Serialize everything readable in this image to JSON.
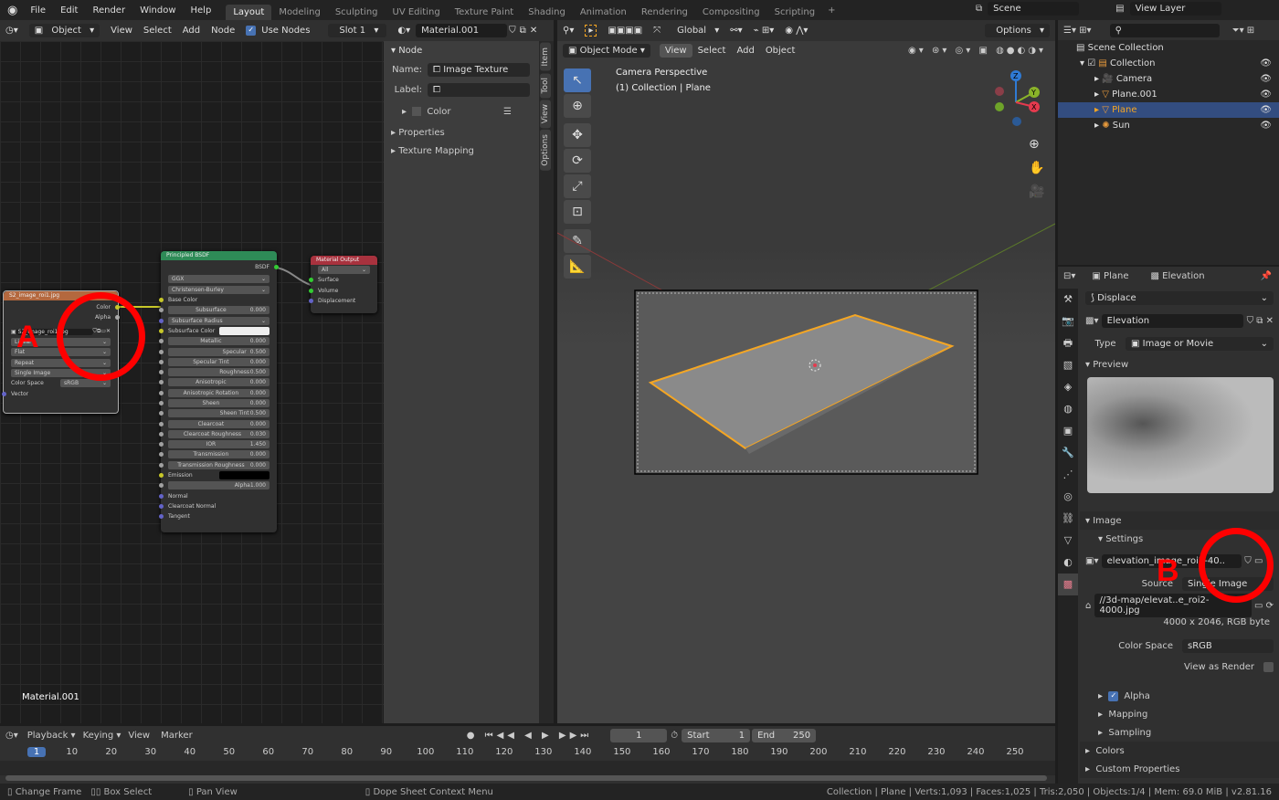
{
  "topbar": {
    "menus": [
      "File",
      "Edit",
      "Render",
      "Window",
      "Help"
    ],
    "workspaces": [
      "Layout",
      "Modeling",
      "Sculpting",
      "UV Editing",
      "Texture Paint",
      "Shading",
      "Animation",
      "Rendering",
      "Compositing",
      "Scripting"
    ],
    "active_workspace": "Layout",
    "add": "+",
    "scene": "Scene",
    "view_layer": "View Layer"
  },
  "node_header": {
    "object": "Object",
    "menus": [
      "View",
      "Select",
      "Add",
      "Node"
    ],
    "use_nodes": "Use Nodes",
    "use_nodes_checked": true,
    "slot": "Slot 1",
    "material": "Material.001"
  },
  "node_editor": {
    "material_label": "Material.001",
    "image_node": {
      "title": "S2_image_roi1.jpg",
      "outputs": [
        "Color",
        "Alpha"
      ],
      "image_name": "S2_image_roi1.jpg",
      "dropdowns": [
        "Linear",
        "Flat",
        "Repeat",
        "Single Image"
      ],
      "color_space_label": "Color Space",
      "color_space": "sRGB",
      "input": "Vector"
    },
    "bsdf_node": {
      "title": "Principled BSDF",
      "output": "BSDF",
      "distribution": "GGX",
      "subsurface_method": "Christensen-Burley",
      "rows": [
        {
          "label": "Base Color",
          "type": "socket"
        },
        {
          "label": "Subsurface",
          "value": "0.000",
          "fill": 0
        },
        {
          "label": "Subsurface Radius",
          "type": "dropdown"
        },
        {
          "label": "Subsurface Color",
          "type": "color",
          "color": "#eeeeee"
        },
        {
          "label": "Metallic",
          "value": "0.000",
          "fill": 0
        },
        {
          "label": "Specular",
          "value": "0.500",
          "fill": 0.5
        },
        {
          "label": "Specular Tint",
          "value": "0.000",
          "fill": 0
        },
        {
          "label": "Roughness",
          "value": "0.500",
          "fill": 0.5
        },
        {
          "label": "Anisotropic",
          "value": "0.000",
          "fill": 0
        },
        {
          "label": "Anisotropic Rotation",
          "value": "0.000",
          "fill": 0
        },
        {
          "label": "Sheen",
          "value": "0.000",
          "fill": 0
        },
        {
          "label": "Sheen Tint",
          "value": "0.500",
          "fill": 0.5
        },
        {
          "label": "Clearcoat",
          "value": "0.000",
          "fill": 0
        },
        {
          "label": "Clearcoat Roughness",
          "value": "0.030",
          "fill": 0.03
        },
        {
          "label": "IOR",
          "value": "1.450",
          "fill": 0
        },
        {
          "label": "Transmission",
          "value": "0.000",
          "fill": 0
        },
        {
          "label": "Transmission Roughness",
          "value": "0.000",
          "fill": 0
        },
        {
          "label": "Emission",
          "type": "color",
          "color": "#000000"
        },
        {
          "label": "Alpha",
          "value": "1.000",
          "fill": 1
        },
        {
          "label": "Normal",
          "type": "socket"
        },
        {
          "label": "Clearcoat Normal",
          "type": "socket"
        },
        {
          "label": "Tangent",
          "type": "socket"
        }
      ]
    },
    "output_node": {
      "title": "Material Output",
      "target": "All",
      "inputs": [
        "Surface",
        "Volume",
        "Displacement"
      ]
    },
    "annotation": "A"
  },
  "npanel": {
    "section": "Node",
    "name_label": "Name:",
    "name": "Image Texture",
    "label_label": "Label:",
    "label": "",
    "color": "Color",
    "properties": "Properties",
    "texture_mapping": "Texture Mapping",
    "tabs": [
      "Item",
      "Tool",
      "View",
      "Options"
    ]
  },
  "viewport": {
    "header_row1": {
      "orientation": "Global",
      "options": "Options"
    },
    "mode": "Object Mode",
    "menus": [
      "View",
      "Select",
      "Add",
      "Object"
    ],
    "info1": "Camera Perspective",
    "info2": "(1) Collection | Plane",
    "gizmo": {
      "x": "X",
      "y": "Y",
      "z": "Z"
    }
  },
  "outliner": {
    "root": "Scene Collection",
    "items": [
      {
        "label": "Collection",
        "depth": 1,
        "icon": "collection-icon"
      },
      {
        "label": "Camera",
        "depth": 2,
        "icon": "camera-icon"
      },
      {
        "label": "Plane.001",
        "depth": 2,
        "icon": "mesh-icon"
      },
      {
        "label": "Plane",
        "depth": 2,
        "icon": "mesh-icon",
        "selected": true
      },
      {
        "label": "Sun",
        "depth": 2,
        "icon": "light-icon"
      }
    ]
  },
  "properties": {
    "object": "Plane",
    "texture": "Elevation",
    "modifier": "Displace",
    "texture_name": "Elevation",
    "type_label": "Type",
    "type": "Image or Movie",
    "preview": "Preview",
    "image": "Image",
    "settings": "Settings",
    "image_name": "elevation_image_roi2-40..",
    "source_label": "Source",
    "source": "Single Image",
    "filepath": "//3d-map/elevat..e_roi2-4000.jpg",
    "image_info": "4000 x 2046,  RGB byte",
    "color_space_label": "Color Space",
    "color_space": "sRGB",
    "view_as_render": "View as Render",
    "alpha": "Alpha",
    "mapping": "Mapping",
    "sampling": "Sampling",
    "colors": "Colors",
    "custom_properties": "Custom Properties",
    "annotation": "B"
  },
  "timeline": {
    "menus": [
      "Playback",
      "Keying",
      "View",
      "Marker"
    ],
    "current_frame": "1",
    "start_label": "Start",
    "start": "1",
    "end_label": "End",
    "end": "250",
    "ticks": [
      "1",
      "10",
      "20",
      "30",
      "40",
      "50",
      "60",
      "70",
      "80",
      "90",
      "100",
      "110",
      "120",
      "130",
      "140",
      "150",
      "160",
      "170",
      "180",
      "190",
      "200",
      "210",
      "220",
      "230",
      "240",
      "250"
    ]
  },
  "status": {
    "change_frame": "Change Frame",
    "box_select": "Box Select",
    "pan_view": "Pan View",
    "context_menu": "Dope Sheet Context Menu",
    "stats": "Collection | Plane | Verts:1,093 | Faces:1,025 | Tris:2,050 | Objects:1/4 | Mem: 69.0 MiB | v2.81.16"
  },
  "colors": {
    "accent": "#4772b3",
    "annotation": "#ff0000",
    "selection": "#f5a623"
  }
}
